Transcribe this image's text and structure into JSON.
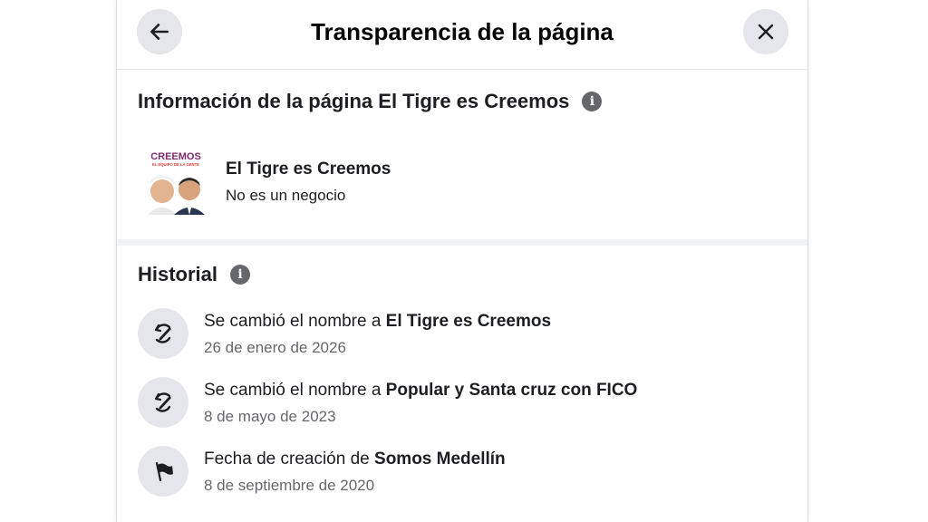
{
  "dialog": {
    "title": "Transparencia de la página",
    "back_icon": "arrow-left-icon",
    "close_icon": "close-icon"
  },
  "page_info": {
    "heading": "Información de la página El Tigre es Creemos",
    "info_icon": "info-icon",
    "page_name": "El Tigre es Creemos",
    "page_type": "No es un negocio",
    "avatar_logo_text": "CREEMOS",
    "avatar_tagline": "EL EQUIPO DE LA GENTE"
  },
  "history": {
    "heading": "Historial",
    "info_icon": "info-icon",
    "items": [
      {
        "icon": "rename-icon",
        "prefix": "Se cambió el nombre a ",
        "highlight": "El Tigre es Creemos",
        "date": "26 de enero de 2026"
      },
      {
        "icon": "rename-icon",
        "prefix": "Se cambió el nombre a ",
        "highlight": "Popular y Santa cruz con FICO",
        "date": "8 de mayo de 2023"
      },
      {
        "icon": "flag-icon",
        "prefix": "Fecha de creación de ",
        "highlight": "Somos Medellín",
        "date": "8 de septiembre de 2020"
      }
    ]
  },
  "colors": {
    "button_bg": "#e4e6eb",
    "secondary_text": "#65676b",
    "primary_text": "#1c1e21",
    "divider": "#f0f2f5"
  }
}
